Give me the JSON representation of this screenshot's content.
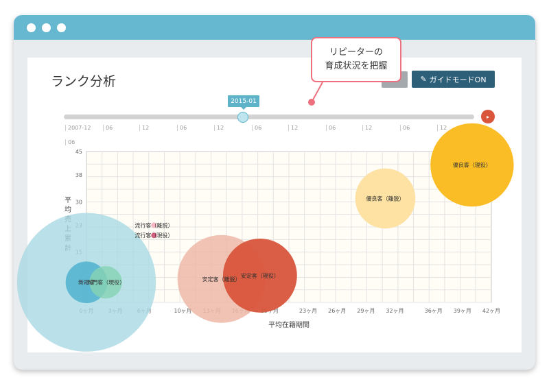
{
  "window": {
    "controls": [
      "close",
      "minimize",
      "maximize"
    ]
  },
  "page": {
    "title": "ランク分析",
    "guide_button": "ガイドモードON",
    "guide_icon": "pen-icon",
    "play_icon": "▸"
  },
  "callout": {
    "line1": "リピーターの",
    "line2": "育成状況を把握"
  },
  "timeline": {
    "current": "2015-01",
    "ticks": [
      "2007-12",
      "06",
      "12",
      "06",
      "12",
      "06",
      "12",
      "06",
      "12",
      "06",
      "12",
      "06",
      "06"
    ]
  },
  "chart_data": {
    "type": "scatter",
    "xlabel": "平均在籍期間",
    "ylabel": "平均売上累計",
    "x_ticks": [
      "0ヶ月",
      "3ヶ月",
      "6ヶ月",
      "10ヶ月",
      "13ヶ月",
      "16ヶ月",
      "19ヶ月",
      "23ヶ月",
      "26ヶ月",
      "29ヶ月",
      "32ヶ月",
      "36ヶ月",
      "39ヶ月",
      "42ヶ月"
    ],
    "y_ticks": [
      "45",
      "38",
      "30",
      "23",
      "15",
      "8"
    ],
    "xlim": [
      0,
      42
    ],
    "ylim": [
      0,
      45
    ],
    "series": [
      {
        "name": "新規客",
        "x": 0,
        "y": 6,
        "r": 3,
        "color": "#a9d9e4",
        "opacity": 0.8
      },
      {
        "name": "新規客",
        "x": 0,
        "y": 6,
        "r": 0.9,
        "color": "#4fb2ce",
        "opacity": 0.85
      },
      {
        "name": "入門客（現役）",
        "x": 2,
        "y": 6,
        "r": 0.7,
        "color": "#86d3b4",
        "opacity": 0.8
      },
      {
        "name": "流行客（離脱）",
        "x": 7,
        "y": 23,
        "r": 0.12,
        "color": "#f6b7c2",
        "opacity": 1
      },
      {
        "name": "流行客（現役）",
        "x": 7,
        "y": 20,
        "r": 0.12,
        "color": "#d06080",
        "opacity": 1
      },
      {
        "name": "安定客（離脱）",
        "x": 14,
        "y": 7,
        "r": 1.9,
        "color": "#edb9a8",
        "opacity": 0.85
      },
      {
        "name": "安定客（現役）",
        "x": 18,
        "y": 8,
        "r": 1.6,
        "color": "#d8553b",
        "opacity": 0.95
      },
      {
        "name": "優良客（離脱）",
        "x": 31,
        "y": 31,
        "r": 1.3,
        "color": "#fde2a4",
        "opacity": 1
      },
      {
        "name": "優良客（現役）",
        "x": 40,
        "y": 41,
        "r": 1.8,
        "color": "#fbbd26",
        "opacity": 1
      }
    ],
    "labels": [
      {
        "text": "新規客",
        "series": 0
      },
      {
        "text": "入門客（現役）",
        "series": 2
      },
      {
        "text": "流行客（離脱）",
        "series": 3
      },
      {
        "text": "流行客（現役）",
        "series": 4
      },
      {
        "text": "安定客（離脱）",
        "series": 5
      },
      {
        "text": "安定客（現役）",
        "series": 6
      },
      {
        "text": "優良客（離脱）",
        "series": 7
      },
      {
        "text": "優良客（現役）",
        "series": 8
      }
    ],
    "colors": {
      "plot_bg": "#fffdf5",
      "grid": "#e3e3e3"
    }
  }
}
